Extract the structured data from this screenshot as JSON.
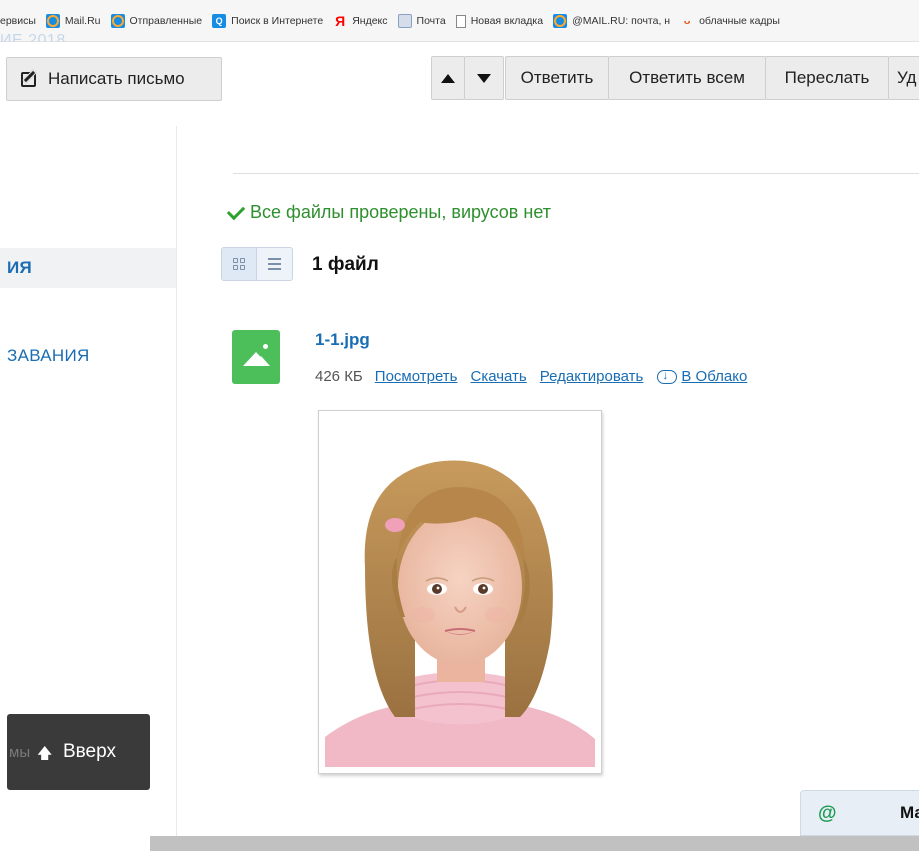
{
  "bookmarks": {
    "items": [
      {
        "label": "ервисы",
        "icon": "none"
      },
      {
        "label": "Mail.Ru",
        "icon": "mailru-icon"
      },
      {
        "label": "Отправленные",
        "icon": "mailru-icon"
      },
      {
        "label": "Поиск в Интернете",
        "icon": "search-icon"
      },
      {
        "label": "Яндекс",
        "icon": "yandex-icon"
      },
      {
        "label": "Почта",
        "icon": "mail-icon"
      },
      {
        "label": "Новая вкладка",
        "icon": "page-icon"
      },
      {
        "label": "@MAIL.RU: почта, н",
        "icon": "mailru-icon"
      },
      {
        "label": "облачные кадры",
        "icon": "cloud-icon"
      }
    ],
    "ghost_title": "ИЕ 2018"
  },
  "toolbar": {
    "compose_label": "Написать письмо",
    "reply_label": "Ответить",
    "reply_all_label": "Ответить всем",
    "forward_label": "Переслать",
    "delete_label": "Уд"
  },
  "sidebar": {
    "active_item": "ИЯ",
    "item2": "ЗАВАНИЯ",
    "up_ghost": "мы",
    "up_label": "Вверх"
  },
  "message": {
    "virus_check": "Все файлы проверены, вирусов нет",
    "file_count": "1 файл"
  },
  "attachment": {
    "name": "1-1.jpg",
    "size": "426 КБ",
    "view": "Посмотреть",
    "download": "Скачать",
    "edit": "Редактировать",
    "to_cloud": "В Облако"
  },
  "agent": {
    "at": "@",
    "label": "Ма"
  },
  "colors": {
    "link": "#1a6db3",
    "success": "#2e8f2e",
    "thumb": "#4cbf5b"
  }
}
